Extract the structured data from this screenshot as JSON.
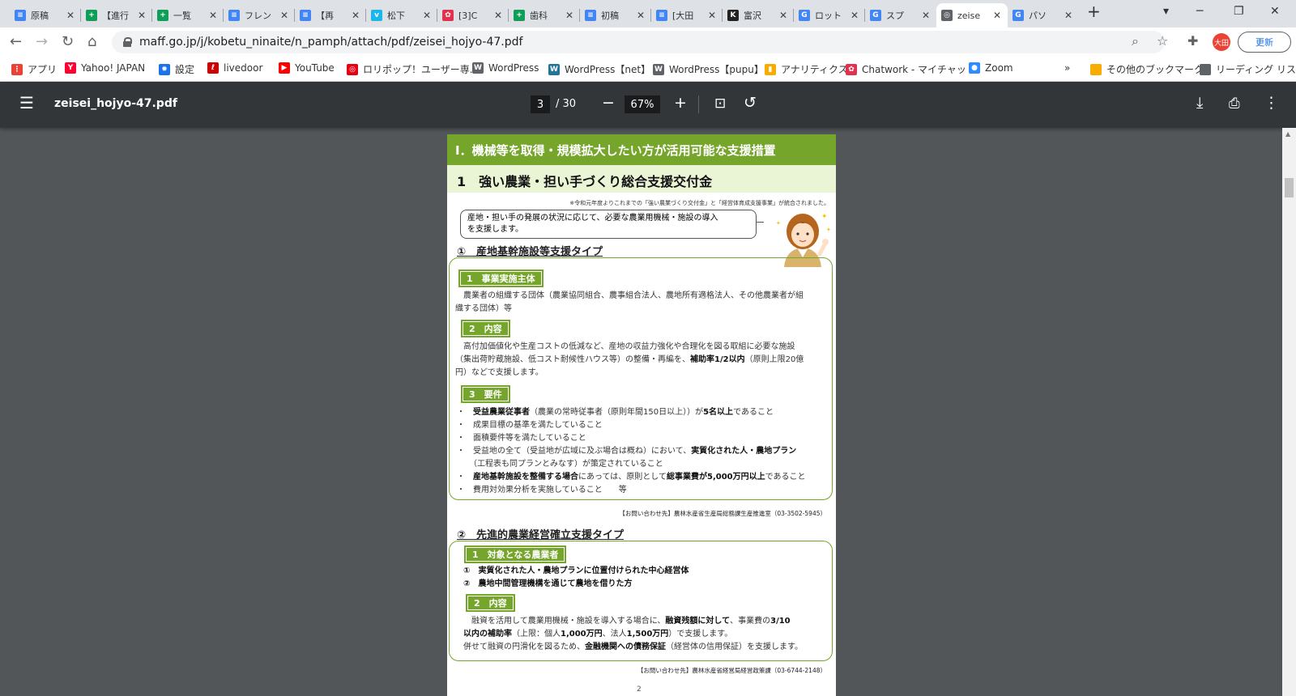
{
  "browser": {
    "tabs": [
      {
        "title": "原稿",
        "fav_color": "#4285f4",
        "fav_glyph": "≡"
      },
      {
        "title": "【進行",
        "fav_color": "#0f9d58",
        "fav_glyph": "+"
      },
      {
        "title": "一覧",
        "fav_color": "#0f9d58",
        "fav_glyph": "+"
      },
      {
        "title": "フレン",
        "fav_color": "#4285f4",
        "fav_glyph": "≡"
      },
      {
        "title": "【再",
        "fav_color": "#4285f4",
        "fav_glyph": "≡"
      },
      {
        "title": "松下",
        "fav_color": "#1ab7ea",
        "fav_glyph": "v"
      },
      {
        "title": "[3]C",
        "fav_color": "#e2304f",
        "fav_glyph": "✿"
      },
      {
        "title": "歯科",
        "fav_color": "#0f9d58",
        "fav_glyph": "+"
      },
      {
        "title": "初稿",
        "fav_color": "#4285f4",
        "fav_glyph": "≡"
      },
      {
        "title": "[大田",
        "fav_color": "#4285f4",
        "fav_glyph": "≡"
      },
      {
        "title": "富沢",
        "fav_color": "#222222",
        "fav_glyph": "K"
      },
      {
        "title": "ロット",
        "fav_color": "#4285f4",
        "fav_glyph": "G"
      },
      {
        "title": "スプ",
        "fav_color": "#4285f4",
        "fav_glyph": "G"
      },
      {
        "title": "zeise",
        "fav_color": "#5f6368",
        "fav_glyph": "◎",
        "active": true
      },
      {
        "title": "パソ",
        "fav_color": "#4285f4",
        "fav_glyph": "G"
      }
    ],
    "url": "maff.go.jp/j/kobetu_ninaite/n_pamph/attach/pdf/zeisei_hojyo-47.pdf",
    "avatar_label": "大田",
    "update_label": "更新",
    "bookmarks": [
      {
        "label": "アプリ",
        "color": "#ea4335",
        "glyph": "⋮"
      },
      {
        "label": "Yahoo! JAPAN",
        "color": "#ff0033",
        "glyph": "Y"
      },
      {
        "label": "設定",
        "color": "#1a73e8",
        "glyph": "✹"
      },
      {
        "label": "livedoor",
        "color": "#c00",
        "glyph": "ℓ"
      },
      {
        "label": "YouTube",
        "color": "#ff0000",
        "glyph": "▶"
      },
      {
        "label": "ロリポップ！ユーザー専...",
        "color": "#e60012",
        "glyph": "◎"
      },
      {
        "label": "WordPress",
        "color": "#5f6368",
        "glyph": "W"
      },
      {
        "label": "WordPress【net】",
        "color": "#21759b",
        "glyph": "W"
      },
      {
        "label": "WordPress【pupu】",
        "color": "#5f6368",
        "glyph": "W"
      },
      {
        "label": "アナリティクス",
        "color": "#f9ab00",
        "glyph": "▮"
      },
      {
        "label": "Chatwork - マイチャット",
        "color": "#e2304f",
        "glyph": "✿"
      },
      {
        "label": "Zoom",
        "color": "#2d8cff",
        "glyph": "●"
      }
    ],
    "more_bookmarks": "»",
    "other_bookmarks": "その他のブックマーク",
    "reading_list": "リーディング リスト"
  },
  "pdf_viewer": {
    "filename": "zeisei_hojyo-47.pdf",
    "current_page": "3",
    "total_pages": "/ 30",
    "zoom": "67%"
  },
  "document": {
    "chapter": "Ⅰ．機械等を取得・規模拡大したい方が活用可能な支援措置",
    "heading": "1　強い農業・担い手づくり総合支援交付金",
    "note": "※令和元年度よりこれまでの「強い農業づくり交付金」と「経営体育成支援事業」が統合されました。",
    "bubble_line1": "産地・担い手の発展の状況に応じて、必要な農業用機械・施設の導入",
    "bubble_line2": "を支援します。",
    "section1": {
      "title": "①　産地基幹施設等支援タイプ",
      "label1": "1　事業実施主体",
      "text1a": "　農業者の組織する団体（農業協同組合、農事組合法人、農地所有適格法人、その他農業者が組",
      "text1b": "織する団体）等",
      "label2": "2　内容",
      "text2a": "　高付加価値化や生産コストの低減など、産地の収益力強化や合理化を図る取組に必要な施設",
      "text2b_pre": "（集出荷貯蔵施設、低コスト耐候性ハウス等）の整備・再編を、",
      "text2b_bold": "補助率1/2以内",
      "text2b_post": "（原則上限20億",
      "text2c": "円）などで支援します。",
      "label3": "3　要件",
      "bullets": [
        {
          "bold": "受益農業従事者",
          "mid": "（農業の常時従事者（原則年間150日以上））が",
          "bold2": "5名以上",
          "post": "であること"
        },
        {
          "bold": "",
          "mid": "成果目標の基準を満たしていること",
          "bold2": "",
          "post": ""
        },
        {
          "bold": "",
          "mid": "面積要件等を満たしていること",
          "bold2": "",
          "post": ""
        },
        {
          "bold": "",
          "mid": "受益地の全て（受益地が広域に及ぶ場合は概ね）において、",
          "bold2": "実質化された人・農地プラン",
          "post": ""
        },
        {
          "bold": "",
          "mid": "（工程表も同プランとみなす）が策定されていること",
          "bold2": "",
          "post": ""
        },
        {
          "bold": "産地基幹施設を整備する場合",
          "mid": "にあっては、原則として",
          "bold2": "総事業費が5,000万円以上",
          "post": "であること"
        },
        {
          "bold": "",
          "mid": "費用対効果分析を実施していること　　等",
          "bold2": "",
          "post": ""
        }
      ],
      "contact": "【お問い合わせ先】農林水産省生産局総務課生産推進室（03-3502-5945）"
    },
    "section2": {
      "title": "②　先進的農業経営確立支援タイプ",
      "label1": "1　対象となる農業者",
      "item1": "①　実質化された人・農地プランに位置付けられた中心経営体",
      "item2": "②　農地中間管理機構を通じて農地を借りた方",
      "label2": "2　内容",
      "t1_pre": "　融資を活用して農業用機械・施設を導入する場合に、",
      "t1_bold": "融資残額に対して",
      "t1_post": "、事業費の",
      "t1_bold2": "3/10",
      "t2_bold": "以内の補助率",
      "t2_mid": "（上限：個人",
      "t2_bold2": "1,000万円",
      "t2_mid2": "、法人",
      "t2_bold3": "1,500万円",
      "t2_post": "）で支援します。",
      "t3_pre": "併せて融資の円滑化を図るため、",
      "t3_bold": "金融機関への債務保証",
      "t3_post": "（経営体の信用保証）を支援します。",
      "contact": "【お問い合わせ先】農林水産省経営局経営政策課（03-6744-2148）"
    },
    "page_number": "2"
  }
}
